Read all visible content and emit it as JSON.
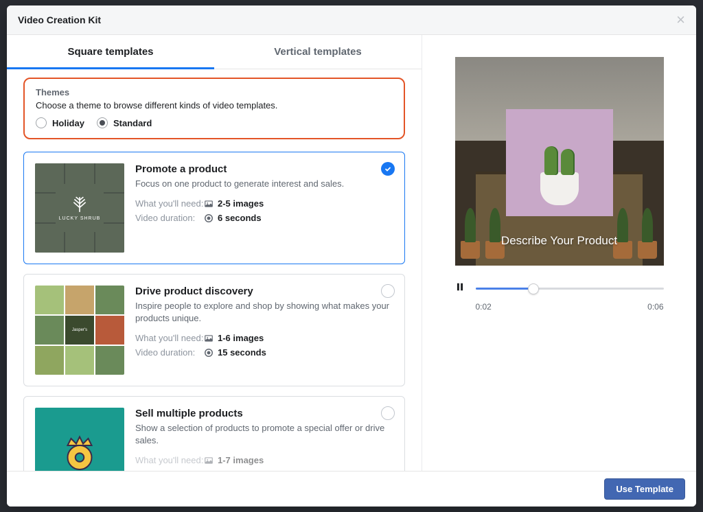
{
  "modal": {
    "title": "Video Creation Kit",
    "tabs": {
      "square": "Square templates",
      "vertical": "Vertical templates"
    },
    "themes": {
      "label": "Themes",
      "desc": "Choose a theme to browse different kinds of video templates.",
      "options": {
        "holiday": "Holiday",
        "standard": "Standard"
      }
    },
    "cards": [
      {
        "title": "Promote a product",
        "desc": "Focus on one product to generate interest and sales.",
        "need_label": "What you'll need:",
        "need_value": "2-5 images",
        "dur_label": "Video duration:",
        "dur_value": "6 seconds",
        "thumb_brand": "LUCKY SHRUB"
      },
      {
        "title": "Drive product discovery",
        "desc": "Inspire people to explore and shop by showing what makes your products unique.",
        "need_label": "What you'll need:",
        "need_value": "1-6 images",
        "dur_label": "Video duration:",
        "dur_value": "15 seconds"
      },
      {
        "title": "Sell multiple products",
        "desc": "Show a selection of products to promote a special offer or drive sales.",
        "need_label": "What you'll need:",
        "need_value": "1-7 images"
      }
    ],
    "preview": {
      "caption": "Describe Your Product"
    },
    "player": {
      "current": "0:02",
      "total": "0:06"
    },
    "footer": {
      "use_template": "Use Template"
    }
  }
}
